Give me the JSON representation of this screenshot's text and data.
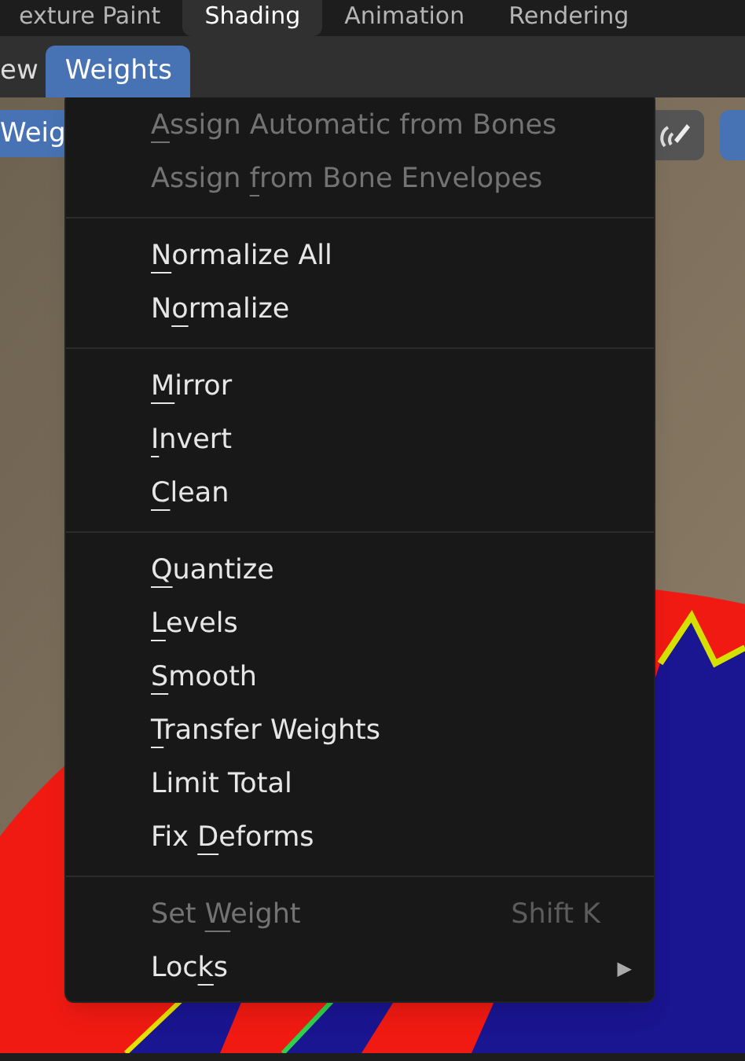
{
  "workspace_tabs": [
    {
      "label": "exture Paint",
      "selected": false
    },
    {
      "label": "Shading",
      "selected": true
    },
    {
      "label": "Animation",
      "selected": false
    },
    {
      "label": "Rendering",
      "selected": false
    }
  ],
  "header_menus": [
    {
      "label": "ew",
      "open": false
    },
    {
      "label": "Weights",
      "open": true
    }
  ],
  "toolbar": {
    "mode_button": "Weig"
  },
  "menu": {
    "sections": [
      [
        {
          "key": "A",
          "post": "ssign Automatic from Bones",
          "disabled": true
        },
        {
          "pre": "Assign ",
          "key": "f",
          "post": "rom Bone Envelopes",
          "disabled": true
        }
      ],
      [
        {
          "key": "N",
          "post": "ormalize All",
          "disabled": false
        },
        {
          "pre": "N",
          "key": "o",
          "post": "rmalize",
          "disabled": false
        }
      ],
      [
        {
          "key": "M",
          "post": "irror",
          "disabled": false
        },
        {
          "key": "I",
          "post": "nvert",
          "disabled": false
        },
        {
          "key": "C",
          "post": "lean",
          "disabled": false
        }
      ],
      [
        {
          "key": "Q",
          "post": "uantize",
          "disabled": false
        },
        {
          "key": "L",
          "post": "evels",
          "disabled": false
        },
        {
          "key": "S",
          "post": "mooth",
          "disabled": false
        },
        {
          "key": "T",
          "post": "ransfer Weights",
          "disabled": false
        },
        {
          "pre": "Limit Total",
          "disabled": false
        },
        {
          "pre": "Fix ",
          "key": "D",
          "post": "eforms",
          "disabled": false
        }
      ],
      [
        {
          "pre": "Set ",
          "key": "W",
          "post": "eight",
          "shortcut": "Shift K",
          "disabled": true
        },
        {
          "pre": "Loc",
          "key": "k",
          "post": "s",
          "submenu": "▶",
          "disabled": false
        }
      ]
    ]
  }
}
